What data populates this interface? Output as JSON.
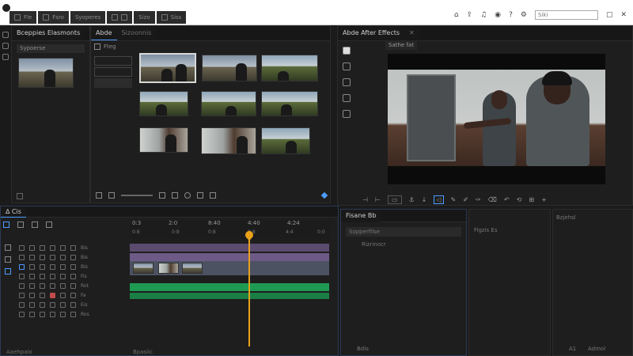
{
  "window": {
    "menus": [
      "Fle",
      "Fsro",
      "Syoperes",
      "Sizo",
      "Siss"
    ],
    "search_placeholder": "Siki",
    "buttons": [
      "▢",
      "—",
      "⊡",
      "✕"
    ]
  },
  "project_panel": {
    "tabs": [
      "Bceppies Elasmonts",
      "Abde",
      "Sizoonnis"
    ],
    "search_label": "Sypoerse",
    "filter_label": "Fteg"
  },
  "after_effects": {
    "tab": "Abde After Effects",
    "subtab": "Sathe fat"
  },
  "timeline": {
    "header": "∆ Cis",
    "ruler": [
      "0:3",
      "2:0",
      "8:40",
      "4:40",
      "4:24"
    ],
    "ruler_small": [
      "0:8",
      "0:8",
      "0:8",
      "0:8",
      "4:4",
      "0:0"
    ],
    "tracks": [
      "Bis",
      "Bis",
      "Bis",
      "Fis",
      "Rot",
      "Fa",
      "Eis",
      "Ros"
    ],
    "bottom_left": "Aaehpaio",
    "bottom_mid": "Bpasiic"
  },
  "properties_panel": {
    "tab": "Fisane Bb",
    "search": "Sopperfilse",
    "item": "Rizrinocr",
    "footer": "Bdis"
  },
  "mid_panel": {
    "label": "Figzis Es"
  },
  "right_panel": {
    "label": "Bzjehsl",
    "footer_left": "A1",
    "footer_right": "Admol"
  },
  "colors": {
    "accent": "#4d9cff",
    "playhead": "#e7a21a",
    "video_track": "#6d5a86",
    "audio_track": "#1f9a53"
  }
}
